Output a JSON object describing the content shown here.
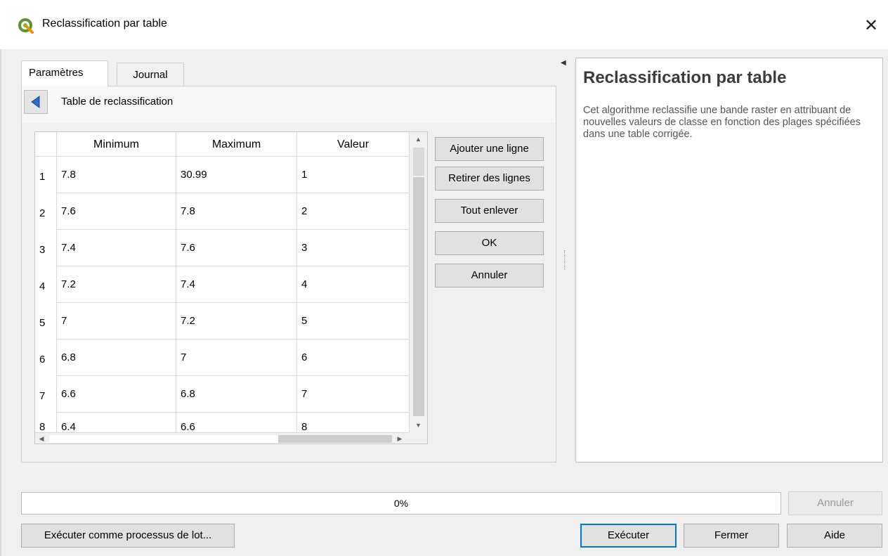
{
  "window": {
    "title": "Reclassification par table",
    "close_glyph": "✕",
    "app_icon": "qgis-icon",
    "accent_color": "#0078d7"
  },
  "tabs": [
    {
      "label": "Paramètres",
      "active": true
    },
    {
      "label": "Journal",
      "active": false
    }
  ],
  "panel": {
    "back_icon": "back-arrow-icon",
    "title": "Table de reclassification"
  },
  "table": {
    "columns": [
      "Minimum",
      "Maximum",
      "Valeur"
    ],
    "rows": [
      {
        "num": "1",
        "min": "7.8",
        "max": "30.99",
        "val": "1"
      },
      {
        "num": "2",
        "min": "7.6",
        "max": "7.8",
        "val": "2"
      },
      {
        "num": "3",
        "min": "7.4",
        "max": "7.6",
        "val": "3"
      },
      {
        "num": "4",
        "min": "7.2",
        "max": "7.4",
        "val": "4"
      },
      {
        "num": "5",
        "min": "7",
        "max": "7.2",
        "val": "5"
      },
      {
        "num": "6",
        "min": "6.8",
        "max": "7",
        "val": "6"
      },
      {
        "num": "7",
        "min": "6.6",
        "max": "6.8",
        "val": "7"
      },
      {
        "num": "8",
        "min": "6.4",
        "max": "6.6",
        "val": "8"
      }
    ]
  },
  "side_buttons": {
    "add_row": "Ajouter une ligne",
    "remove_rows": "Retirer des lignes",
    "clear_all": "Tout enlever",
    "ok": "OK",
    "cancel": "Annuler"
  },
  "help": {
    "title": "Reclassification par table",
    "description": "Cet algorithme reclassifie une bande raster en attribuant de nouvelles valeurs de classe en fonction des plages spécifiées dans une table corrigée."
  },
  "progress": {
    "value": 0,
    "text": "0%",
    "cancel_label": "Annuler"
  },
  "footer": {
    "batch_label": "Exécuter comme processus de lot...",
    "run_label": "Exécuter",
    "close_label": "Fermer",
    "help_label": "Aide"
  }
}
